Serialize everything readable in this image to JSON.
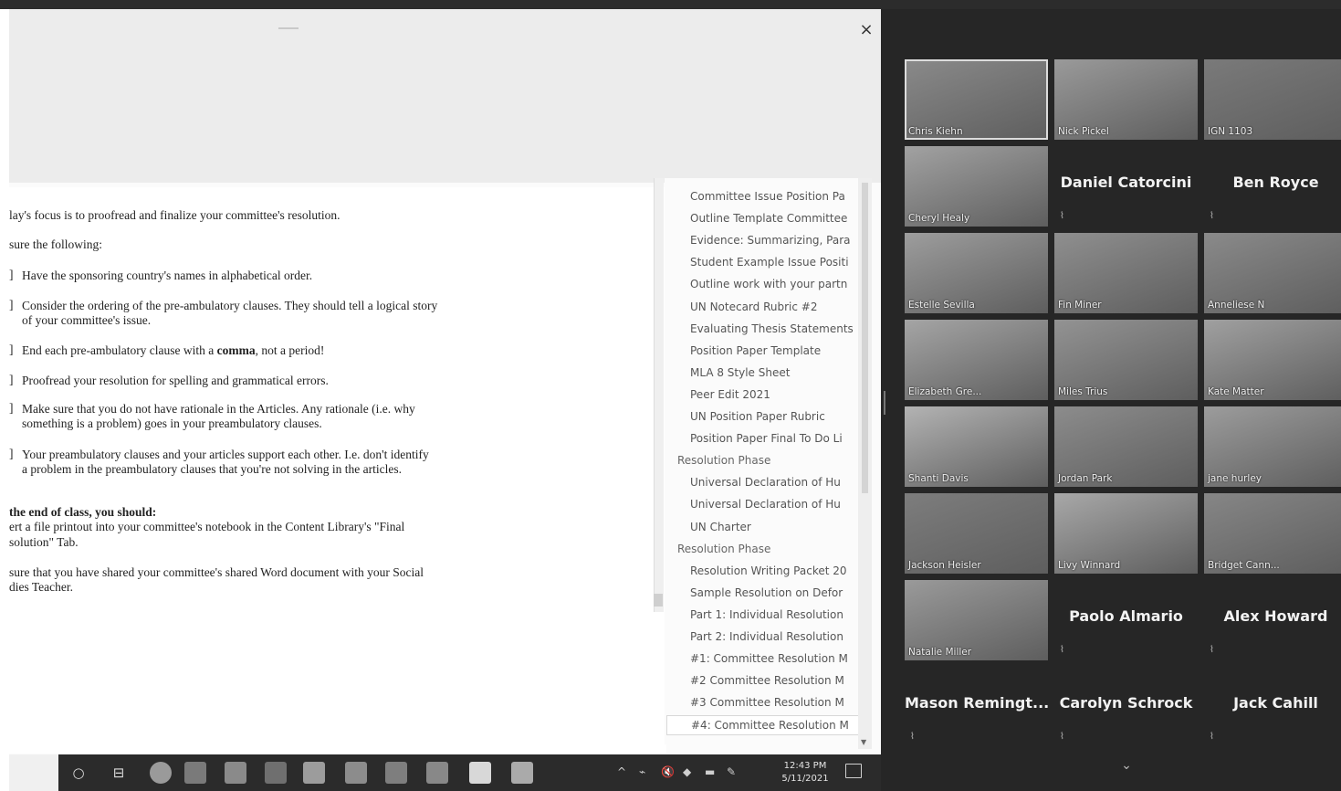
{
  "document": {
    "close_glyph": "×",
    "line1": "lay's focus is to proofread and finalize your committee's resolution.",
    "line2": "sure the following:",
    "bullets": [
      {
        "lines": [
          "Have the sponsoring country's names in alphabetical order."
        ]
      },
      {
        "lines": [
          "Consider the ordering of the pre-ambulatory clauses. They should tell a logical story",
          "of your committee's issue."
        ]
      },
      {
        "pre": "End each pre-ambulatory clause with a ",
        "bold": "comma",
        "post": ", not a period!"
      },
      {
        "lines": [
          "Proofread your resolution for spelling and grammatical errors."
        ]
      },
      {
        "lines": [
          "Make sure that you do not have rationale in the Articles. Any rationale (i.e. why",
          "something is a problem) goes in your preambulatory clauses."
        ]
      },
      {
        "lines": [
          "Your preambulatory clauses and your articles support each other. I.e. don't identify",
          "a problem in the preambulatory clauses that you're not solving in the articles."
        ]
      }
    ],
    "end_heading": "the end of class, you should:",
    "end_line1": "ert a file printout into your committee's notebook in the Content Library's \"Final",
    "end_line2": "solution\" Tab.",
    "share_line1": "sure that you have shared your committee's shared Word document with your Social",
    "share_line2": "dies Teacher."
  },
  "page_list": [
    {
      "label": "Committee Issue Position Pa",
      "kind": "page"
    },
    {
      "label": "Outline Template Committee",
      "kind": "page"
    },
    {
      "label": "Evidence: Summarizing, Para",
      "kind": "page"
    },
    {
      "label": "Student Example Issue Positi",
      "kind": "page"
    },
    {
      "label": "Outline work with your partn",
      "kind": "page"
    },
    {
      "label": "UN Notecard Rubric #2",
      "kind": "page"
    },
    {
      "label": "Evaluating Thesis Statements",
      "kind": "page"
    },
    {
      "label": "Position Paper Template",
      "kind": "page"
    },
    {
      "label": "MLA 8 Style Sheet",
      "kind": "page"
    },
    {
      "label": "Peer Edit 2021",
      "kind": "page"
    },
    {
      "label": "UN Position Paper Rubric",
      "kind": "page"
    },
    {
      "label": "Position Paper Final To Do Li",
      "kind": "page"
    },
    {
      "label": "Resolution Phase",
      "kind": "section"
    },
    {
      "label": "Universal Declaration of Hu",
      "kind": "page"
    },
    {
      "label": "Universal Declaration of Hu",
      "kind": "page"
    },
    {
      "label": "UN Charter",
      "kind": "page"
    },
    {
      "label": "Resolution Phase",
      "kind": "section"
    },
    {
      "label": "Resolution Writing Packet 20",
      "kind": "page"
    },
    {
      "label": "Sample Resolution on Defor",
      "kind": "page"
    },
    {
      "label": "Part 1: Individual Resolution",
      "kind": "page"
    },
    {
      "label": "Part 2: Individual Resolution",
      "kind": "page"
    },
    {
      "label": "#1: Committee Resolution M",
      "kind": "page"
    },
    {
      "label": "#2 Committee Resolution M",
      "kind": "page"
    },
    {
      "label": "#3 Committee Resolution M",
      "kind": "page"
    },
    {
      "label": "#4: Committee Resolution M",
      "kind": "page",
      "selected": true
    }
  ],
  "taskbar": {
    "start_glyph": "○",
    "task_view_glyph": "⊟",
    "apps": [
      "chrome-icon",
      "onenote-icon",
      "file-explorer-icon",
      "teams-icon",
      "paint-icon",
      "edge-icon",
      "outlook-icon",
      "word-icon",
      "notepad-icon",
      "zoom-icon"
    ],
    "tray_glyphs": [
      "^",
      "⌁",
      "🔇",
      "◆",
      "▬",
      "✎"
    ],
    "time": "12:43 PM",
    "date": "5/11/2021"
  },
  "participants": [
    {
      "name": "Chris Kiehn",
      "video": true,
      "bg": "#8a8a8a",
      "active": true
    },
    {
      "name": "Nick Pickel",
      "video": true,
      "bg": "#9a9a9a"
    },
    {
      "name": "IGN 1103",
      "video": true,
      "bg": "#7a7a7a"
    },
    {
      "name": "Cheryl Healy",
      "video": true,
      "bg": "#a2a2a2"
    },
    {
      "name": "Daniel Catorcini",
      "video": false
    },
    {
      "name": "Ben Royce",
      "video": false
    },
    {
      "name": "Estelle Sevilla",
      "video": true,
      "bg": "#9d9d9d"
    },
    {
      "name": "Fin Miner",
      "video": true,
      "bg": "#8f8f8f"
    },
    {
      "name": "Anneliese N",
      "video": true,
      "bg": "#8a8a8a"
    },
    {
      "name": "Elizabeth Gre...",
      "video": true,
      "bg": "#a5a5a5"
    },
    {
      "name": "Miles Trius",
      "video": true,
      "bg": "#939393"
    },
    {
      "name": "Kate Matter",
      "video": true,
      "bg": "#a0a0a0"
    },
    {
      "name": "Shanti Davis",
      "video": true,
      "bg": "#b3b3b3"
    },
    {
      "name": "Jordan Park",
      "video": true,
      "bg": "#8c8c8c"
    },
    {
      "name": "jane hurley",
      "video": true,
      "bg": "#9c9c9c"
    },
    {
      "name": "Jackson Heisler",
      "video": true,
      "bg": "#7d7d7d"
    },
    {
      "name": "Livy Winnard",
      "video": true,
      "bg": "#a8a8a8"
    },
    {
      "name": "Bridget Cann...",
      "video": true,
      "bg": "#868686"
    },
    {
      "name": "Natalie Miller",
      "video": true,
      "bg": "#9a9a9a"
    },
    {
      "name": "Paolo Almario",
      "video": false
    },
    {
      "name": "Alex Howard",
      "video": false
    },
    {
      "name": "Mason  Remingt...",
      "video": false
    },
    {
      "name": "Carolyn Schrock",
      "video": false
    },
    {
      "name": "Jack Cahill",
      "video": false
    }
  ],
  "zoom": {
    "more_glyph": "⌄"
  }
}
